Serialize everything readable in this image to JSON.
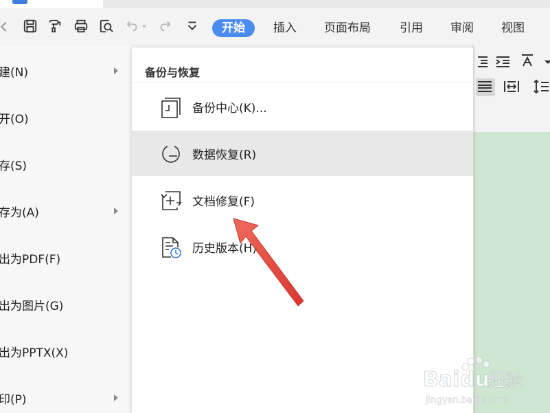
{
  "colors": {
    "accent": "#4a8cf0",
    "annotation_arrow": "#e8453c",
    "doc_background": "#cfe7d1"
  },
  "quick_access": {
    "icons": [
      "save-icon",
      "format-painter-icon",
      "print-icon",
      "print-preview-icon",
      "undo-icon",
      "redo-icon",
      "customize-dropdown-icon"
    ]
  },
  "menu_tabs": [
    "开始",
    "插入",
    "页面布局",
    "引用",
    "审阅",
    "视图"
  ],
  "file_menu": {
    "items": [
      {
        "label": "建(N)",
        "has_submenu": true
      },
      {
        "label": "开(O)",
        "has_submenu": false
      },
      {
        "label": "存(S)",
        "has_submenu": false
      },
      {
        "label": "存为(A)",
        "has_submenu": true
      },
      {
        "label": "出为PDF(F)",
        "has_submenu": false
      },
      {
        "label": "出为图片(G)",
        "has_submenu": false
      },
      {
        "label": "出为PPTX(X)",
        "has_submenu": false
      },
      {
        "label": "印(P)",
        "has_submenu": true
      }
    ]
  },
  "backup_menu": {
    "title": "备份与恢复",
    "items": [
      {
        "label": "备份中心(K)...",
        "icon": "backup-center-icon"
      },
      {
        "label": "数据恢复(R)",
        "icon": "data-recovery-icon",
        "highlighted": true
      },
      {
        "label": "文档修复(F)",
        "icon": "document-repair-icon"
      },
      {
        "label": "历史版本(H)",
        "icon": "history-version-icon"
      }
    ]
  },
  "watermark": {
    "brand": "Bai",
    "brand_suffix": "du",
    "product": "经验",
    "url": "jingyan.baidu.com"
  }
}
